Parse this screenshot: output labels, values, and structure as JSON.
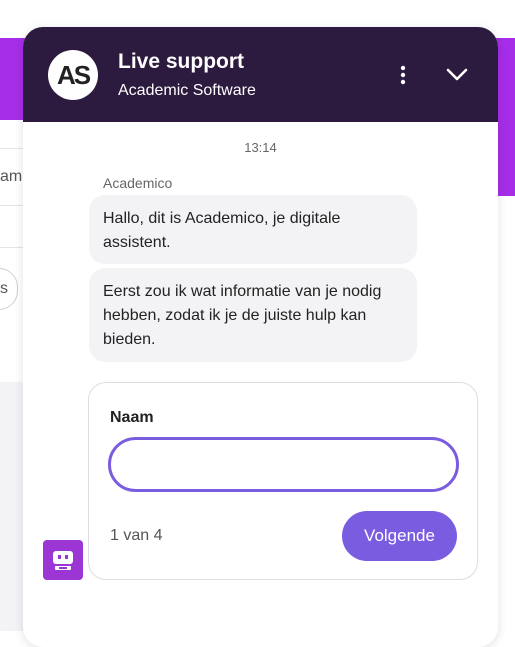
{
  "background": {
    "fragment_text_1": "am",
    "fragment_text_2": "s"
  },
  "header": {
    "avatar_text": "AS",
    "title": "Live support",
    "subtitle": "Academic Software",
    "menu_icon": "more-vertical-icon",
    "collapse_icon": "chevron-down-icon"
  },
  "conversation": {
    "timestamp": "13:14",
    "sender": "Academico",
    "messages": [
      "Hallo, dit is Academico, je digitale assistent.",
      "Eerst zou ik wat informatie van je nodig hebben, zodat ik je de juiste hulp kan bieden."
    ]
  },
  "form": {
    "field_label": "Naam",
    "field_value": "",
    "step_text": "1 van 4",
    "next_label": "Volgende"
  },
  "bot": {
    "icon": "robot-icon"
  },
  "colors": {
    "header_bg": "#2c1a3f",
    "accent": "#7a5ce0",
    "page_strip": "#a62ee8",
    "bot_icon": "#9b35d4",
    "bubble_bg": "#f3f3f6"
  }
}
